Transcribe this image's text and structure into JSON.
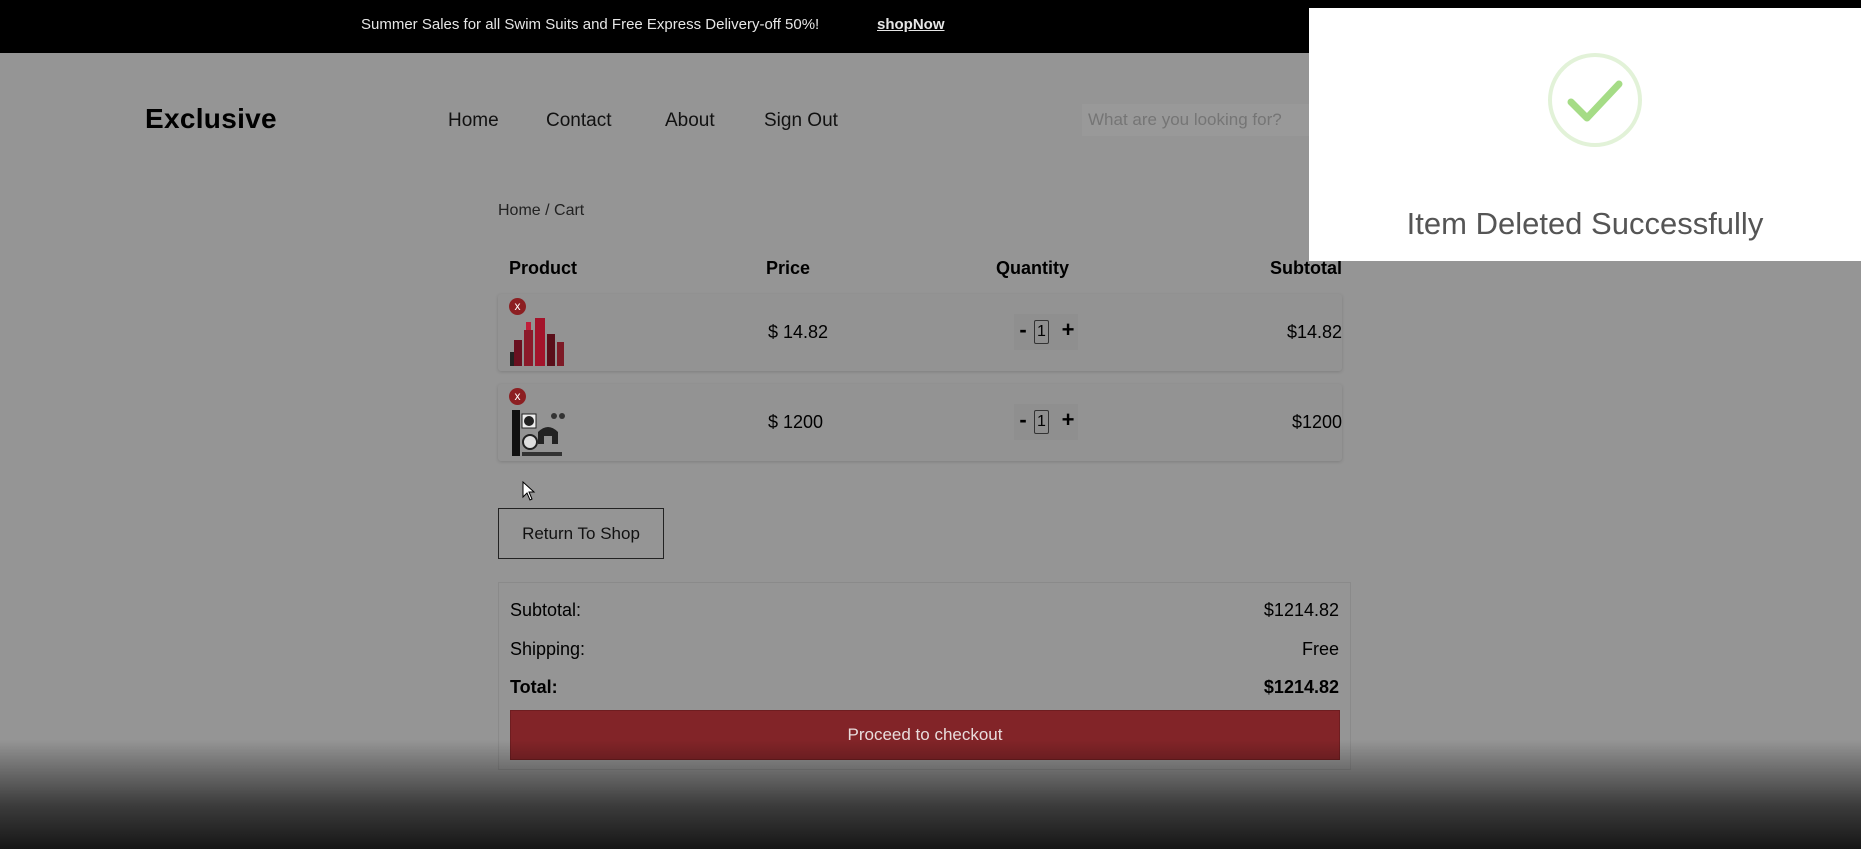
{
  "topbar": {
    "promo": "Summer Sales for all Swim Suits and Free Express Delivery-off 50%!",
    "shop_now": "shopNow"
  },
  "header": {
    "logo": "Exclusive",
    "nav": [
      "Home",
      "Contact",
      "About",
      "Sign Out"
    ],
    "search_placeholder": "What are you looking for?"
  },
  "breadcrumb": "Home / Cart",
  "table": {
    "headers": {
      "product": "Product",
      "price": "Price",
      "quantity": "Quantity",
      "subtotal": "Subtotal"
    },
    "rows": [
      {
        "remove": "x",
        "image": "lipstick-set-image",
        "price": "$ 14.82",
        "qty_minus": "-",
        "quantity": "1",
        "qty_plus": "+",
        "subtotal": "$14.82"
      },
      {
        "remove": "x",
        "image": "gaming-console-image",
        "price": "$ 1200",
        "qty_minus": "-",
        "quantity": "1",
        "qty_plus": "+",
        "subtotal": "$1200"
      }
    ]
  },
  "return_button": "Return To Shop",
  "totals": {
    "subtotal_label": "Subtotal:",
    "subtotal_value": "$1214.82",
    "shipping_label": "Shipping:",
    "shipping_value": "Free",
    "total_label": "Total:",
    "total_value": "$1214.82",
    "checkout_button": "Proceed to checkout"
  },
  "toast": {
    "icon": "check-circle-icon",
    "message": "Item Deleted Successfully",
    "accent": "#a5dc86"
  }
}
